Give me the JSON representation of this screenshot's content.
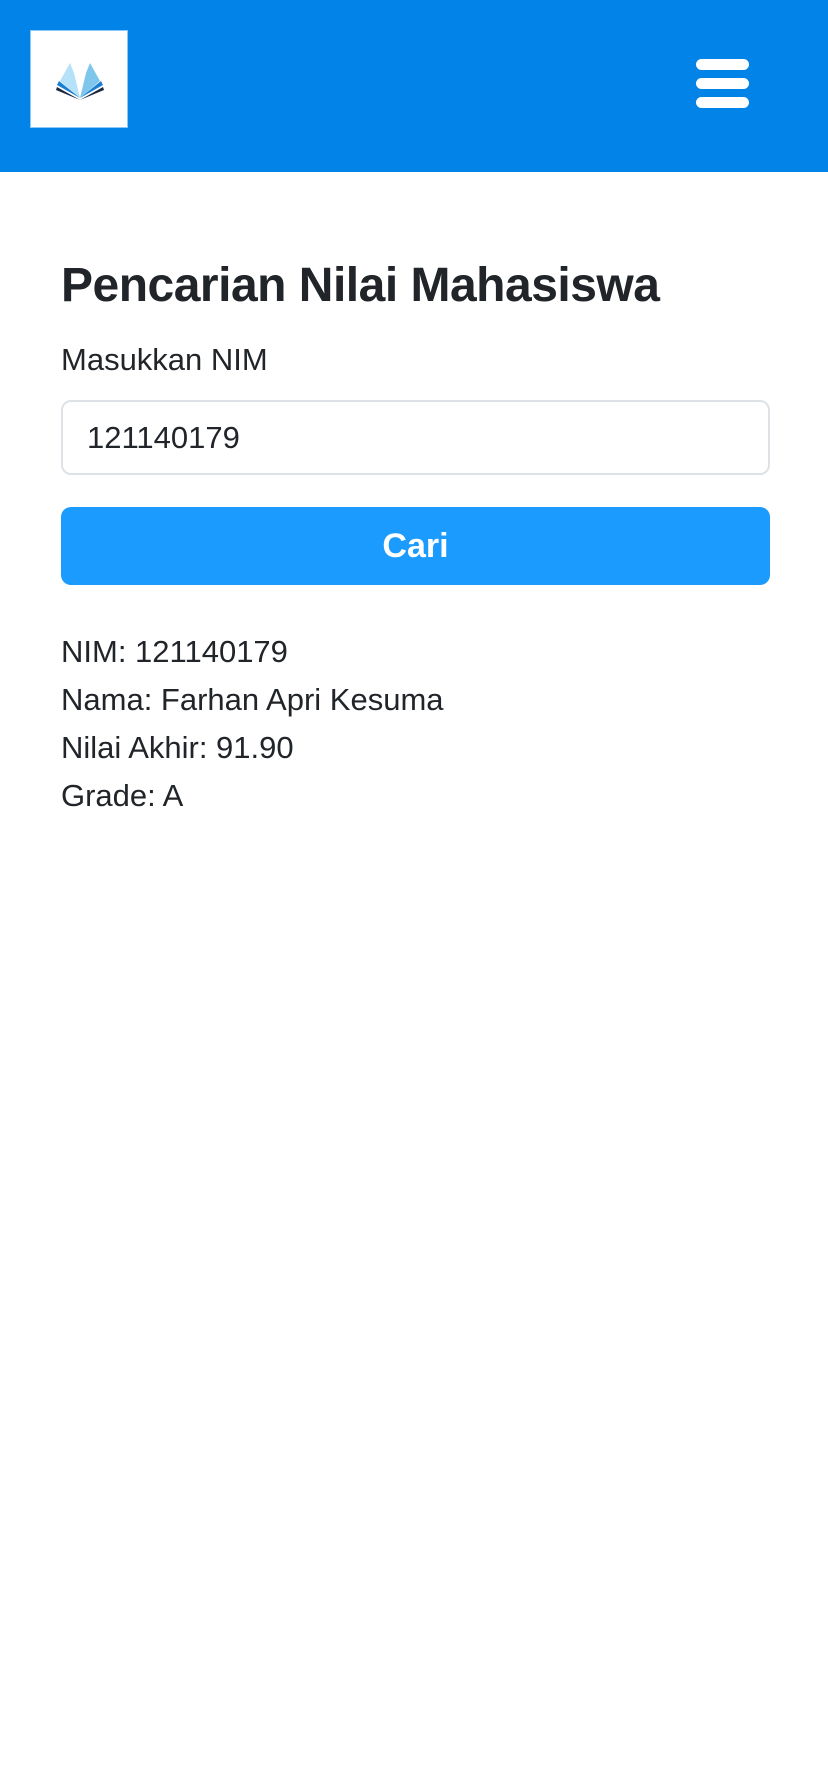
{
  "navbar": {
    "brand_color": "#0283e7",
    "logo_icon": "open-book-logo",
    "menu_icon": "hamburger-icon"
  },
  "page": {
    "title": "Pencarian Nilai Mahasiswa",
    "nim_label": "Masukkan NIM",
    "nim_value": "121140179",
    "search_button": "Cari",
    "button_color": "#1c9bff"
  },
  "result": {
    "nim": "NIM: 121140179",
    "nama": "Nama: Farhan Apri Kesuma",
    "nilai": "Nilai Akhir: 91.90",
    "grade": "Grade: A"
  }
}
